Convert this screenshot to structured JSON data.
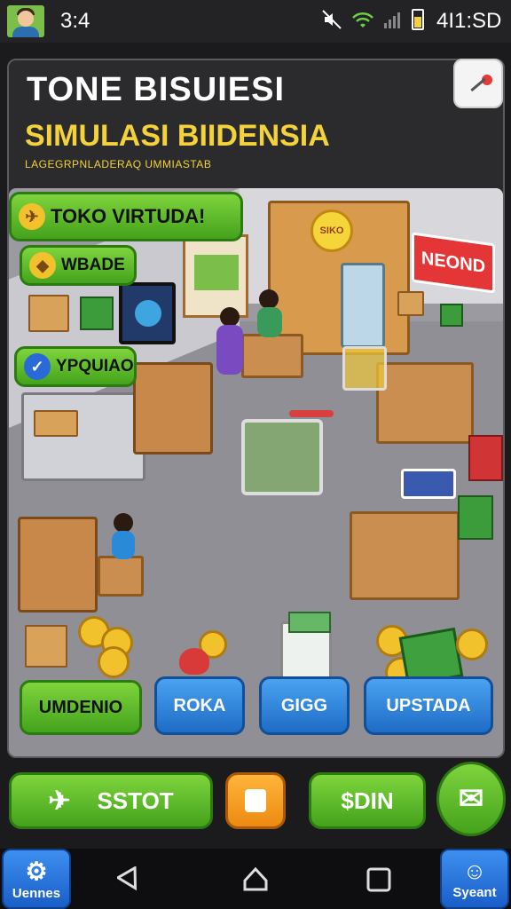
{
  "status_bar": {
    "time_left": "3:4",
    "time_right": "4I1:SD"
  },
  "header": {
    "title": "TONE BISUIESI",
    "subtitle_main": "SIMULASI BIIDENSIA",
    "subtitle_small": "LAGEGRPNLADERAQ UMMIASTAB"
  },
  "scene": {
    "shop_sign": "SIKO",
    "neon_sign": "NEOND"
  },
  "side_buttons": {
    "toko_virtual": "TOKO VIRTUDA!",
    "wbade": "WBADE",
    "ypquiao": "YPQUIAO"
  },
  "action_buttons": {
    "umdenio": "UMDENIO",
    "roka": "ROKA",
    "gigg": "GIGG",
    "upstada": "UPSTADA"
  },
  "bottom_bar": {
    "sstot": "SSTOT",
    "sdin": "$DIN"
  },
  "nav": {
    "left_label": "Uennes",
    "right_label": "Syeant"
  },
  "colors": {
    "accent_yellow": "#f4d23a",
    "button_green": "#44a21c",
    "button_blue": "#1e6cc6",
    "panel_bg": "#2b2b2d"
  }
}
